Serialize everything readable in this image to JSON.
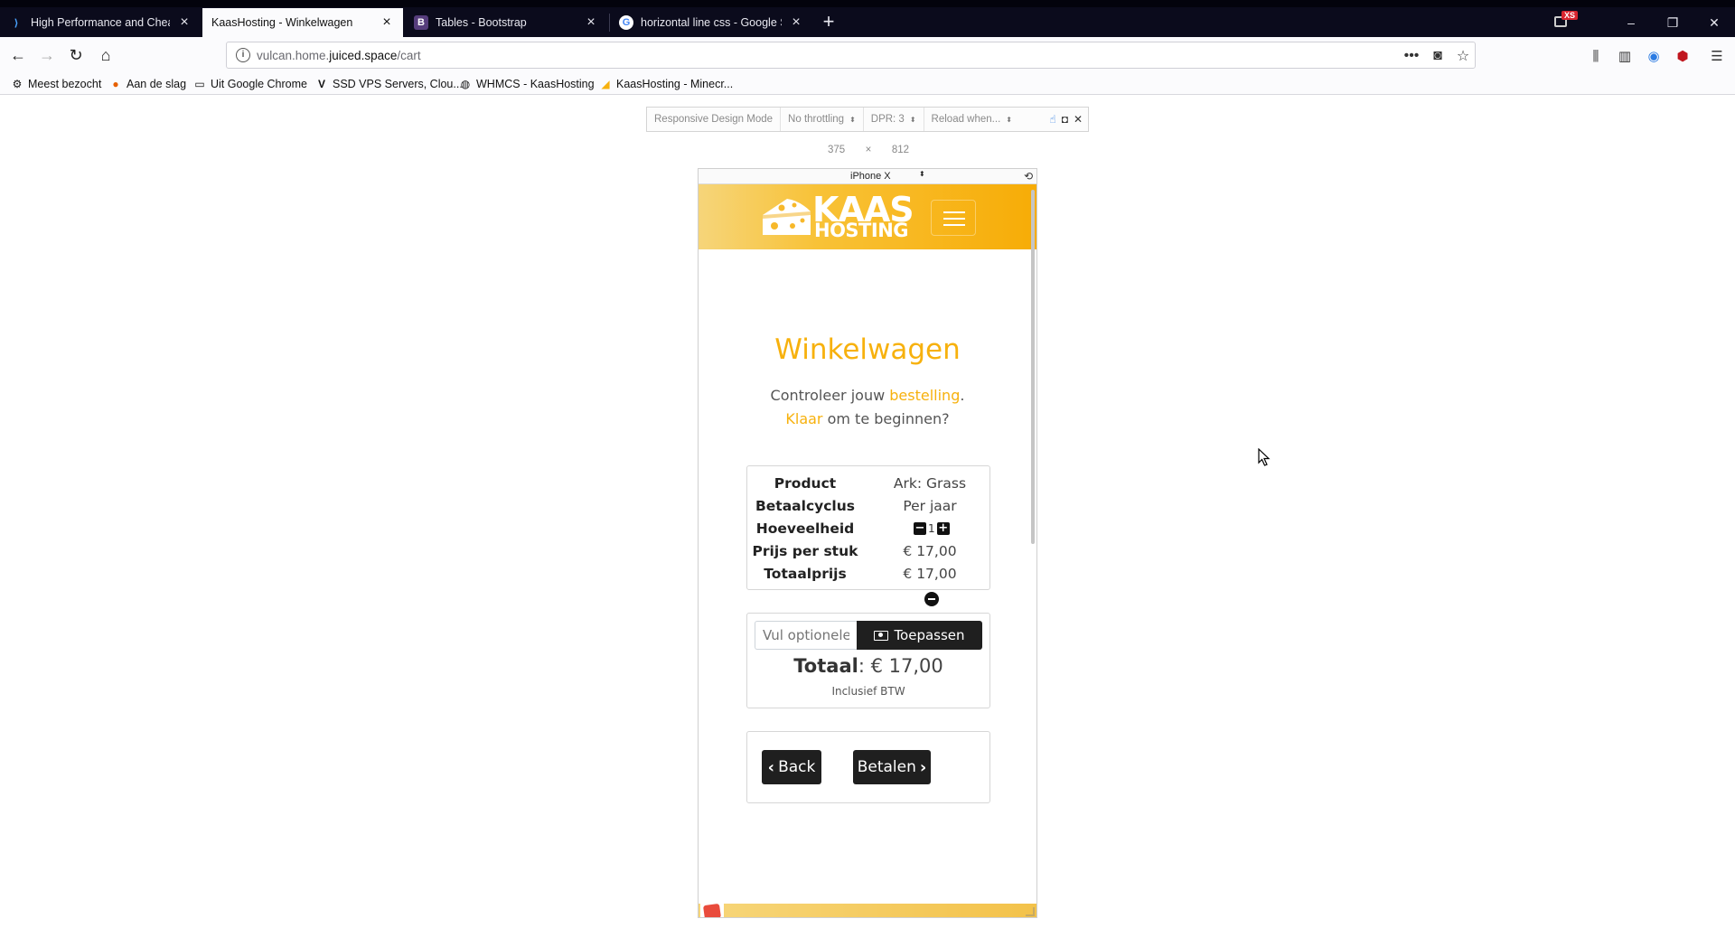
{
  "browser": {
    "tabs": [
      {
        "title": "High Performance and Cheap C",
        "icon": "juiced-icon",
        "active": false
      },
      {
        "title": "KaasHosting - Winkelwagen",
        "icon": "",
        "active": true
      },
      {
        "title": "Tables - Bootstrap",
        "icon": "bootstrap-icon",
        "active": false
      },
      {
        "title": "horizontal line css - Google Sea",
        "icon": "google-icon",
        "active": false
      }
    ],
    "ext_badge": "XS",
    "url": {
      "prefix": "vulcan.home.",
      "domain": "juiced.space",
      "path": "/cart"
    },
    "bookmarks": [
      {
        "label": "Meest bezocht",
        "icon": "gear-icon"
      },
      {
        "label": "Aan de slag",
        "icon": "firefox-icon"
      },
      {
        "label": "Uit Google Chrome",
        "icon": "folder-icon"
      },
      {
        "label": "SSD VPS Servers, Clou...",
        "icon": "vultr-icon"
      },
      {
        "label": "WHMCS - KaasHosting",
        "icon": "globe-icon"
      },
      {
        "label": "KaasHosting - Minecr...",
        "icon": "cheese-icon"
      }
    ]
  },
  "rdm": {
    "title": "Responsive Design Mode",
    "throttling": "No throttling",
    "dpr": "DPR: 3",
    "reload": "Reload when...",
    "width": "375",
    "times": "×",
    "height": "812",
    "device": "iPhone X"
  },
  "site": {
    "logo_top": "KAAS",
    "logo_bottom": "HOSTING",
    "title": "Winkelwagen",
    "subtitle": {
      "part1": "Controleer jouw ",
      "hl1": "bestelling",
      "part2": ".",
      "hl2": "Klaar",
      "part3": " om te beginnen?"
    },
    "cart": {
      "rows": [
        {
          "label": "Product",
          "value": "Ark: Grass"
        },
        {
          "label": "Betaalcyclus",
          "value": "Per jaar"
        },
        {
          "label": "Hoeveelheid",
          "value": "1"
        },
        {
          "label": "Prijs per stuk",
          "value": "€ 17,00"
        },
        {
          "label": "Totaalprijs",
          "value": "€ 17,00"
        }
      ]
    },
    "promo": {
      "placeholder": "Vul optionele",
      "button": "Toepassen"
    },
    "total": {
      "label": "Totaal",
      "value": ": € 17,00",
      "note": "Inclusief BTW"
    },
    "actions": {
      "back": "Back",
      "pay": "Betalen"
    }
  },
  "colors": {
    "accent": "#f7b10d",
    "dark": "#1f1f1f"
  }
}
